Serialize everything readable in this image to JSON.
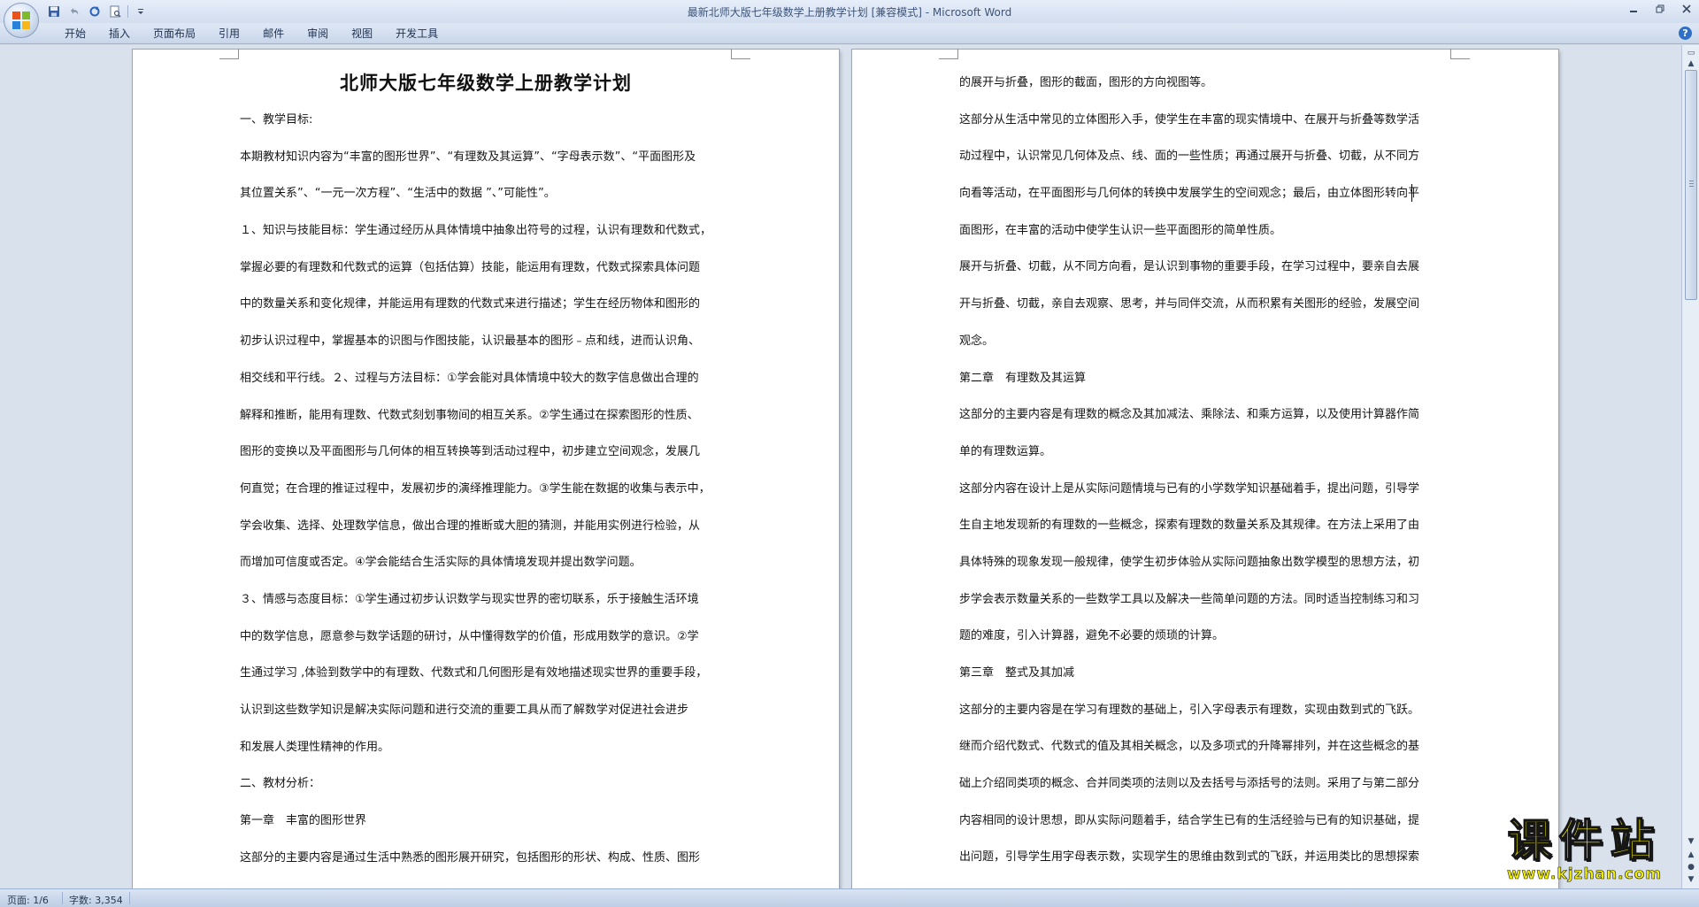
{
  "window": {
    "title": "最新北师大版七年级数学上册教学计划 [兼容模式] - Microsoft Word"
  },
  "quick_access": {
    "items": [
      "save-icon",
      "undo-icon",
      "redo-icon",
      "print-preview-icon",
      "customize-icon"
    ]
  },
  "ribbon": {
    "tabs": [
      "开始",
      "插入",
      "页面布局",
      "引用",
      "邮件",
      "审阅",
      "视图",
      "开发工具"
    ]
  },
  "document": {
    "left_page": {
      "title": "北师大版七年级数学上册教学计划",
      "lines": [
        "一、教学目标:",
        "本期教材知识内容为“丰富的图形世界”、“有理数及其运算”、“字母表示数”、“平面图形及",
        "其位置关系”、“一元一次方程”、“生活中的数据 ”、”可能性”。",
        "１、知识与技能目标：学生通过经历从具体情境中抽象出符号的过程，认识有理数和代数式，",
        "掌握必要的有理数和代数式的运算（包括估算）技能，能运用有理数，代数式探索具体问题",
        "中的数量关系和变化规律，并能运用有理数的代数式来进行描述；学生在经历物体和图形的",
        "初步认识过程中，掌握基本的识图与作图技能，认识最基本的图形﹣点和线，进而认识角、",
        "相交线和平行线。２、过程与方法目标：①学会能对具体情境中较大的数字信息做出合理的",
        "解释和推断，能用有理数、代数式刻划事物间的相互关系。②学生通过在探索图形的性质、",
        "图形的变换以及平面图形与几何体的相互转换等到活动过程中，初步建立空间观念，发展几",
        "何直觉；在合理的推证过程中，发展初步的演绎推理能力。③学生能在数据的收集与表示中，",
        "学会收集、选择、处理数学信息，做出合理的推断或大胆的猜测，并能用实例进行检验，从",
        "而增加可信度或否定。④学会能结合生活实际的具体情境发现并提出数学问题。",
        "３、情感与态度目标：①学生通过初步认识数学与现实世界的密切联系，乐于接触生活环境",
        "中的数学信息，愿意参与数学话题的研讨，从中懂得数学的价值，形成用数学的意识。②学",
        "生通过学习 ,体验到数学中的有理数、代数式和几何图形是有效地描述现实世界的重要手段，",
        "认识到这些数学知识是解决实际问题和进行交流的重要工具从而了解数学对促进社会进步",
        "和发展人类理性精神的作用。",
        "二、教材分析：",
        "第一章　丰富的图形世界",
        "这部分的主要内容是通过生活中熟悉的图形展开研究，包括图形的形状、构成、性质、图形"
      ]
    },
    "right_page": {
      "lines": [
        "的展开与折叠，图形的截面，图形的方向视图等。",
        "这部分从生活中常见的立体图形入手，使学生在丰富的现实情境中、在展开与折叠等数学活",
        "动过程中，认识常见几何体及点、线、面的一些性质；再通过展开与折叠、切截，从不同方",
        "向看等活动，在平面图形与几何体的转换中发展学生的空间观念；最后，由立体图形转向平",
        "面图形，在丰富的活动中使学生认识一些平面图形的简单性质。",
        "展开与折叠、切截，从不同方向看，是认识到事物的重要手段，在学习过程中，要亲自去展",
        "开与折叠、切截，亲自去观察、思考，并与同伴交流，从而积累有关图形的经验，发展空间",
        "观念。",
        "第二章　有理数及其运算",
        "这部分的主要内容是有理数的概念及其加减法、乘除法、和乘方运算，以及使用计算器作简",
        "单的有理数运算。",
        "这部分内容在设计上是从实际问题情境与已有的小学数学知识基础着手，提出问题，引导学",
        "生自主地发现新的有理数的一些概念，探索有理数的数量关系及其规律。在方法上采用了由",
        "具体特殊的现象发现一般规律，使学生初步体验从实际问题抽象出数学模型的思想方法，初",
        "步学会表示数量关系的一些数学工具以及解决一些简单问题的方法。同时适当控制练习和习",
        "题的难度，引入计算器，避免不必要的烦琐的计算。",
        "第三章　整式及其加减",
        "这部分的主要内容是在学习有理数的基础上，引入字母表示有理数，实现由数到式的飞跃。",
        "继而介绍代数式、代数式的值及其相关概念，以及多项式的升降幂排列，并在这些概念的基",
        "础上介绍同类项的概念、合并同类项的法则以及去括号与添括号的法则。采用了与第二部分",
        "内容相同的设计思想，即从实际问题着手，结合学生已有的生活经验与已有的知识基础，提",
        "出问题，引导学生用字母表示数，实现学生的思维由数到式的飞跃，并运用类比的思想探索"
      ]
    }
  },
  "status_bar": {
    "page": "页面: 1/6",
    "word_count": "字数: 3,354"
  },
  "watermark": {
    "text": "课件站",
    "url": "www.kjzhan.com"
  },
  "colors": {
    "titlebar": "#dbe5f4",
    "workspace": "#d9e1ec",
    "page": "#ffffff",
    "watermark": "#f2ef00"
  }
}
